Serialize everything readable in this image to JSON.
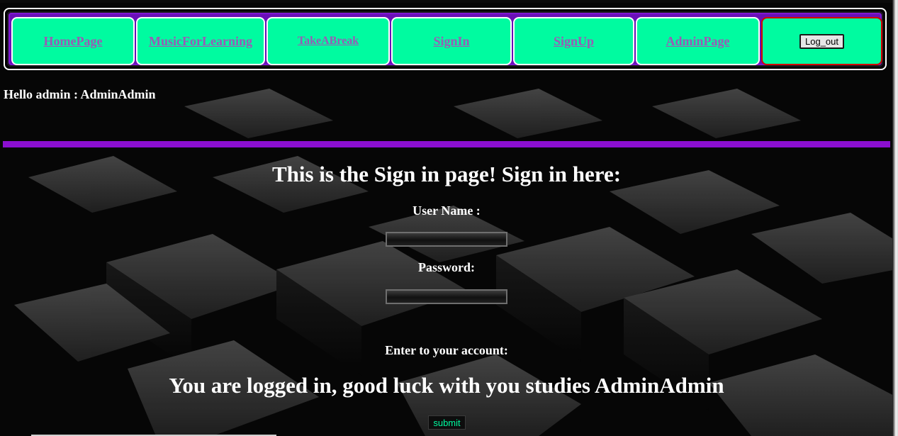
{
  "navbar": {
    "items": [
      {
        "label": "HomePage"
      },
      {
        "label": "MusicForLearning"
      },
      {
        "label": "TakeABreak"
      },
      {
        "label": "SignIn"
      },
      {
        "label": "SignUp"
      },
      {
        "label": "AdminPage"
      }
    ],
    "logout_label": "Log_out"
  },
  "greeting": "Hello admin : AdminAdmin",
  "main": {
    "heading": "This is the Sign in page! Sign in here:",
    "username_label": "User Name :",
    "password_label": "Password:",
    "enter_label": "Enter to your account:",
    "logged_in_message": "You are logged in, good luck with you studies AdminAdmin",
    "submit_label": "submit"
  },
  "colors": {
    "nav_button": "#00fba0",
    "nav_link": "#9b59b6",
    "nav_frame": "#6a0fb6",
    "divider": "#8b0fd0",
    "logout_border": "#d30000",
    "background": "#000000"
  }
}
